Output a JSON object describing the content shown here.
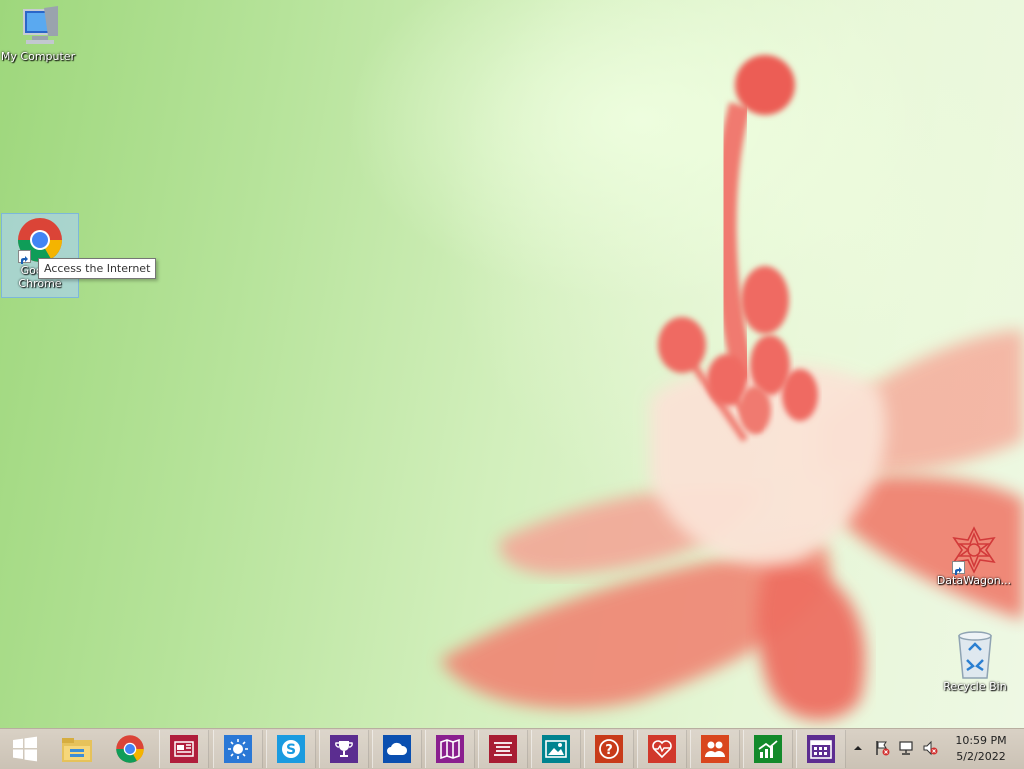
{
  "desktop": {
    "icons": [
      {
        "label": "My Computer"
      },
      {
        "label": "Google Chrome",
        "label_line1": "Google",
        "label_line2": "Chrome"
      },
      {
        "label": "DataWagon..."
      },
      {
        "label": "Recycle Bin"
      }
    ],
    "tooltip": "Access the Internet"
  },
  "taskbar": {
    "start_icon": "windows-logo-icon",
    "pinned": [
      {
        "name": "file-explorer",
        "icon": "folder-icon"
      },
      {
        "name": "google-chrome",
        "icon": "chrome-icon"
      },
      {
        "name": "news",
        "icon": "news-icon",
        "color": "#b01e3c"
      },
      {
        "name": "weather",
        "icon": "sun-icon",
        "color": "#2a78d6"
      },
      {
        "name": "skype",
        "icon": "skype-icon",
        "color": "#1a9be0"
      },
      {
        "name": "sports",
        "icon": "trophy-icon",
        "color": "#5b2d90"
      },
      {
        "name": "onedrive",
        "icon": "cloud-icon",
        "color": "#0a4fb0"
      },
      {
        "name": "maps",
        "icon": "map-icon",
        "color": "#8a1f8f"
      },
      {
        "name": "reading-list",
        "icon": "list-icon",
        "color": "#a81d33"
      },
      {
        "name": "photos",
        "icon": "photo-icon",
        "color": "#00838f"
      },
      {
        "name": "help-tips",
        "icon": "question-icon",
        "color": "#c83b1a"
      },
      {
        "name": "health-fitness",
        "icon": "heart-icon",
        "color": "#d1382b"
      },
      {
        "name": "people",
        "icon": "people-icon",
        "color": "#d9461e"
      },
      {
        "name": "money",
        "icon": "chart-icon",
        "color": "#138a2b"
      },
      {
        "name": "calendar",
        "icon": "calendar-icon",
        "color": "#5c2d91"
      }
    ],
    "tray": {
      "show_hidden_icon": "chevron-up-icon",
      "action_center_icon": "flag-icon",
      "network_icon": "network-icon",
      "volume_icon": "volume-muted-icon"
    },
    "clock": {
      "time": "10:59 PM",
      "date": "5/2/2022"
    }
  }
}
